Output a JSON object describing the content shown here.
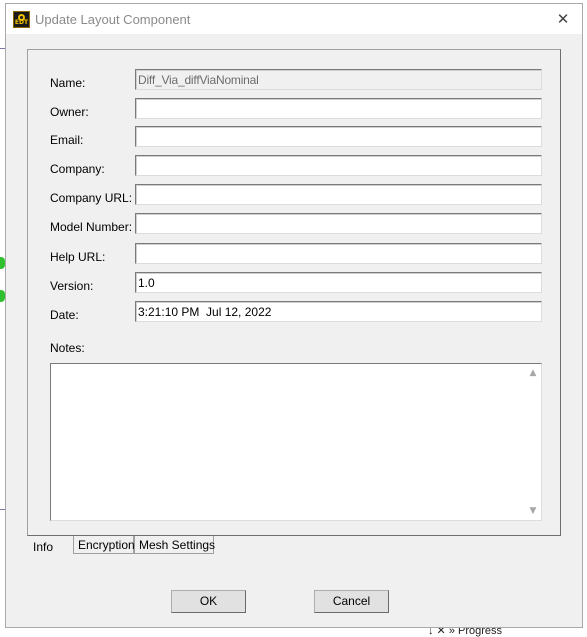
{
  "dialog": {
    "title": "Update Layout Component",
    "icon_text": "EDT",
    "close_glyph": "✕"
  },
  "fields": [
    {
      "label": "Name:",
      "value": "Diff_Via_diffViaNominal",
      "readonly": true
    },
    {
      "label": "Owner:",
      "value": ""
    },
    {
      "label": "Email:",
      "value": ""
    },
    {
      "label": "Company:",
      "value": ""
    },
    {
      "label": "Company URL:",
      "value": ""
    },
    {
      "label": "Model Number:",
      "value": ""
    },
    {
      "label": "Help URL:",
      "value": ""
    },
    {
      "label": "Version:",
      "value": "1.0"
    },
    {
      "label": "Date:",
      "value": "3:21:10 PM  Jul 12, 2022"
    }
  ],
  "notes": {
    "label": "Notes:",
    "value": ""
  },
  "tabs": [
    "Info",
    "Encryption",
    "Mesh Settings"
  ],
  "buttons": {
    "ok": "OK",
    "cancel": "Cancel"
  },
  "background": {
    "status_text": "↓ ✕ » Progress"
  },
  "icons": {
    "scroll_up": "▲",
    "scroll_down": "▼"
  }
}
